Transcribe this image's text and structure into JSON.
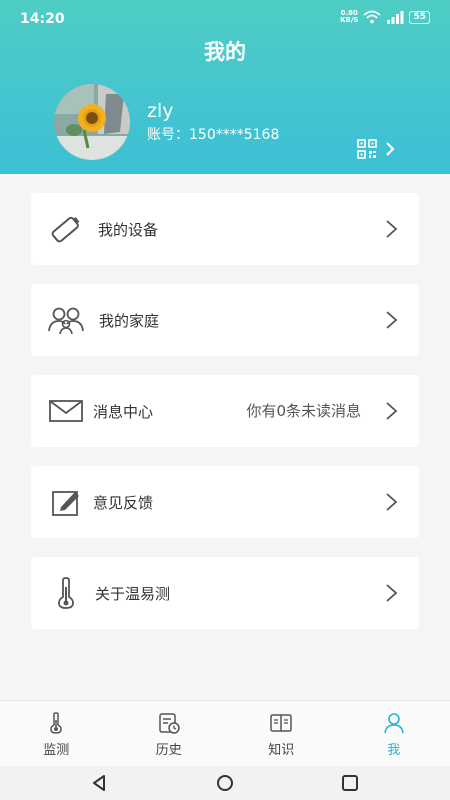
{
  "status_bar": {
    "time": "14:20",
    "net_speed_value": "0.80",
    "net_speed_unit": "KB/S",
    "battery": "55"
  },
  "header": {
    "title": "我的",
    "username": "zly",
    "account_label": "账号：",
    "account_number": "150****5168"
  },
  "menu": [
    {
      "label": "我的设备",
      "icon": "device-icon"
    },
    {
      "label": "我的家庭",
      "icon": "family-icon"
    },
    {
      "label": "消息中心",
      "icon": "mail-icon",
      "extra": "你有0条未读消息"
    },
    {
      "label": "意见反馈",
      "icon": "feedback-icon"
    },
    {
      "label": "关于温易测",
      "icon": "thermometer-icon"
    }
  ],
  "bottom_nav": [
    {
      "label": "监测",
      "icon": "thermometer-icon"
    },
    {
      "label": "历史",
      "icon": "history-icon"
    },
    {
      "label": "知识",
      "icon": "book-icon"
    },
    {
      "label": "我",
      "icon": "person-icon",
      "active": true
    }
  ],
  "colors": {
    "header_start": "#4fcdc5",
    "header_end": "#3dbfd6",
    "accent": "#28b3d2"
  }
}
